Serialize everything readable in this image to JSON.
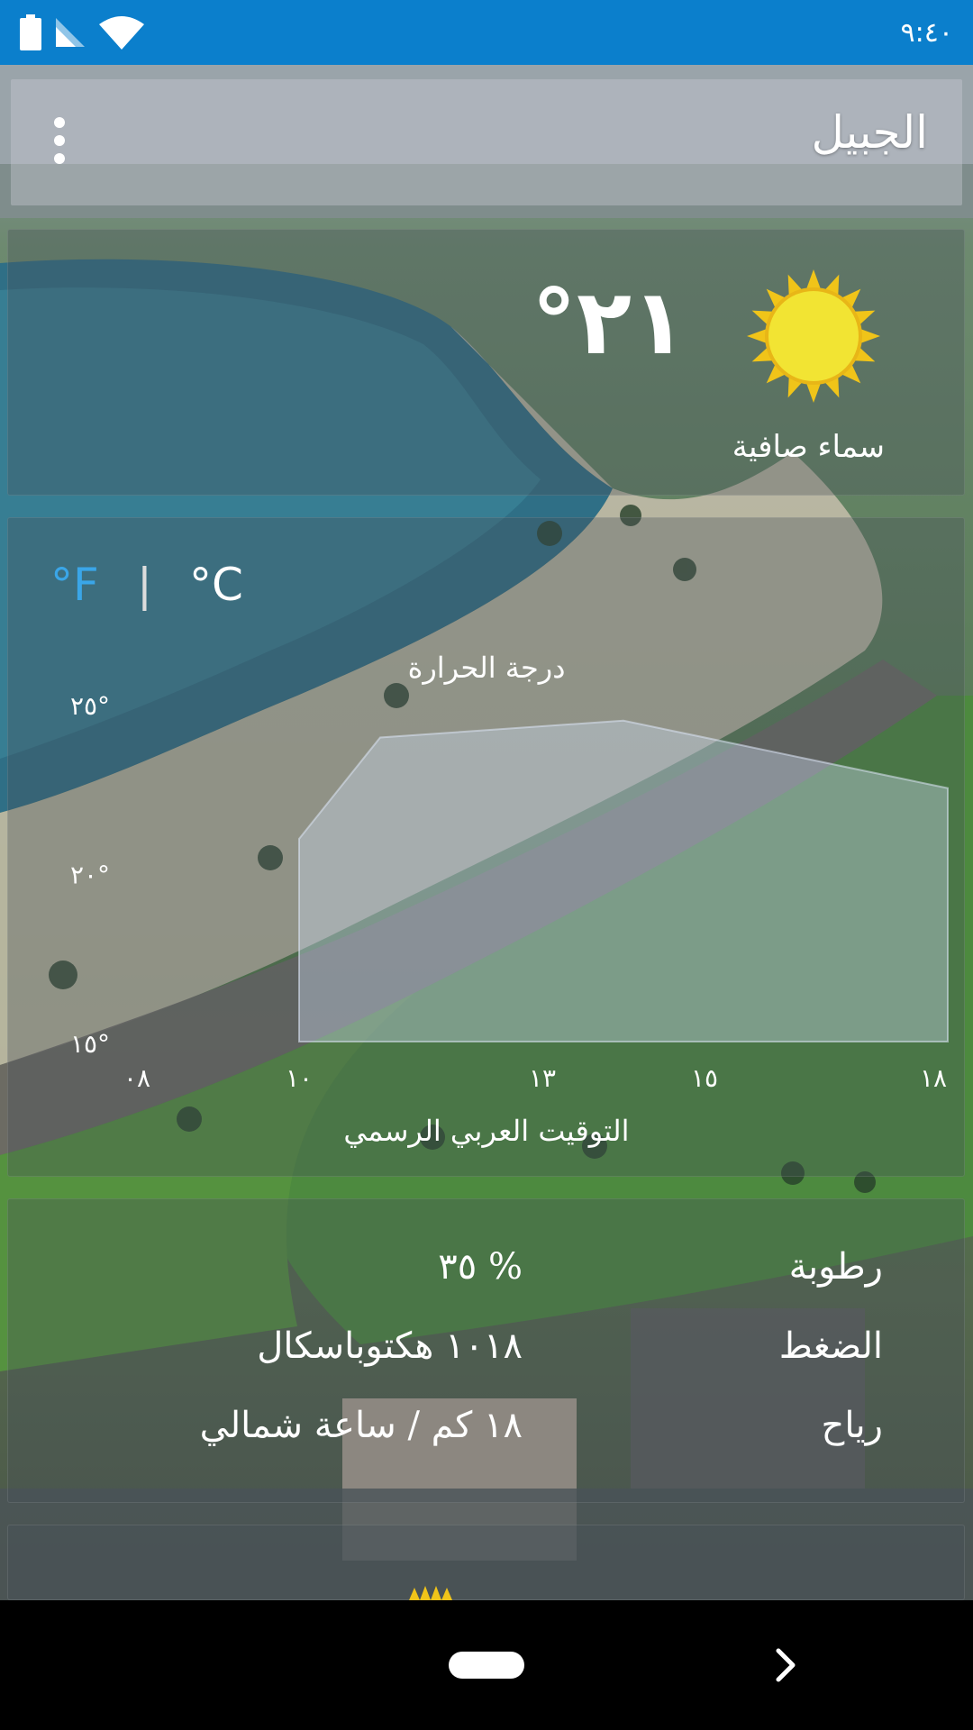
{
  "status_bar": {
    "time": "٩:٤٠"
  },
  "app_bar": {
    "city": "الجبيل"
  },
  "current": {
    "temperature": "°٢١",
    "condition": "سماء صافية",
    "icon": "sun-icon"
  },
  "units": {
    "fahrenheit": "°F",
    "separator": "|",
    "celsius": "°C",
    "active": "celsius"
  },
  "chart_data": {
    "type": "area",
    "title": "درجة الحرارة",
    "xlabel": "التوقيت العربي الرسمي",
    "ylabel": "",
    "x_ticks": [
      "٠٨",
      "١٠",
      "١٣",
      "١٥",
      "١٨"
    ],
    "y_ticks": [
      "٢٥°",
      "٢٠°",
      "١٥°"
    ],
    "ylim": [
      15,
      25
    ],
    "x": [
      10,
      11,
      14,
      18
    ],
    "values": [
      21,
      24,
      24.5,
      22.5
    ],
    "grid": false
  },
  "details": [
    {
      "label": "رطوبة",
      "value": "٣٥ %"
    },
    {
      "label": "الضغط",
      "value": "١٠١٨ هكتوباسكال"
    },
    {
      "label": "رياح",
      "value": "١٨ كم / ساعة شمالي"
    }
  ],
  "colors": {
    "status_bar": "#0b7fcc",
    "fahrenheit_accent": "#3aa6e8",
    "sun": "#f2e433",
    "sun_rays": "#f0c419"
  }
}
